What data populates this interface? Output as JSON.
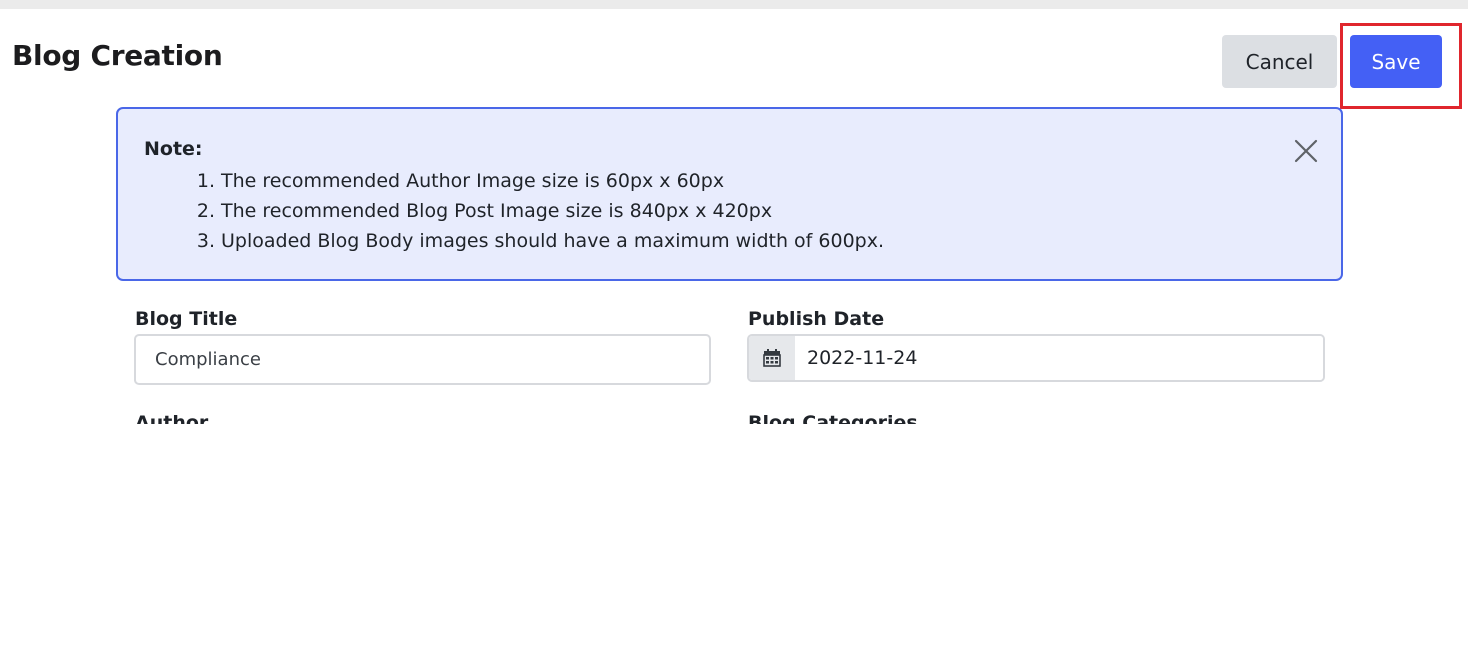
{
  "page": {
    "title": "Blog Creation"
  },
  "actions": {
    "cancel_label": "Cancel",
    "save_label": "Save"
  },
  "note": {
    "heading": "Note:",
    "items": [
      {
        "num": "1.",
        "text": "The recommended Author Image size is 60px x 60px"
      },
      {
        "num": "2.",
        "text": "The recommended Blog Post Image size is 840px x 420px"
      },
      {
        "num": "3.",
        "text": "Uploaded Blog Body images should have a maximum width of 600px."
      }
    ],
    "close_icon": "close-icon"
  },
  "form": {
    "blog_title_label": "Blog Title",
    "blog_title_value": "Compliance",
    "publish_date_label": "Publish Date",
    "publish_date_value": "2022-11-24",
    "calendar_icon": "calendar-icon",
    "author_label": "Author",
    "blog_category_label": "Blog Categories"
  },
  "colors": {
    "accent": "#4460f5",
    "note_border": "#4a67e8",
    "note_background": "#e8ecfd",
    "highlight": "#e0262d"
  }
}
